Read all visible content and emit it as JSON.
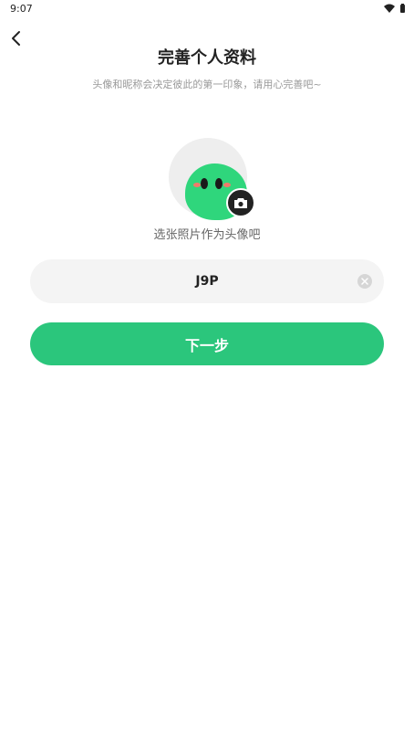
{
  "status_bar": {
    "time": "9:07"
  },
  "header": {
    "title": "完善个人资料",
    "subtitle": "头像和昵称会决定彼此的第一印象，请用心完善吧~"
  },
  "avatar": {
    "hint": "选张照片作为头像吧"
  },
  "nickname": {
    "value": "J9P"
  },
  "actions": {
    "next_label": "下一步"
  },
  "colors": {
    "accent": "#2bc67c",
    "avatar_green": "#2fd67c",
    "input_bg": "#f4f4f4"
  },
  "icons": [
    "chevron-left-icon",
    "wifi-icon",
    "battery-icon",
    "camera-icon",
    "clear-icon"
  ]
}
